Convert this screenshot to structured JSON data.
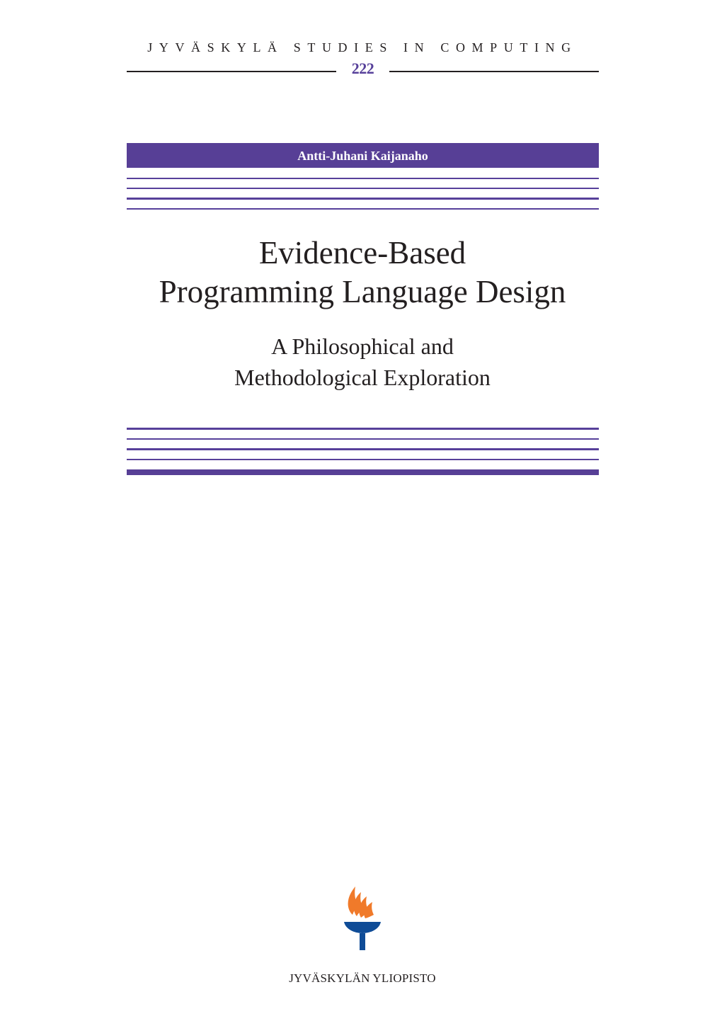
{
  "series": {
    "title": "JYVÄSKYLÄ STUDIES IN COMPUTING",
    "number": "222"
  },
  "author": "Antti-Juhani Kaijanaho",
  "title": {
    "lines": [
      "Evidence-Based",
      "Programming Language Design"
    ]
  },
  "subtitle": {
    "lines": [
      "A Philosophical and",
      "Methodological Exploration"
    ]
  },
  "logo": {
    "icon": "torch-icon",
    "flame_color": "#f07a2a",
    "bowl_color": "#0f4c97"
  },
  "publisher": "JYVÄSKYLÄN YLIOPISTO",
  "colors": {
    "accent": "#573f96",
    "text": "#231f20"
  }
}
